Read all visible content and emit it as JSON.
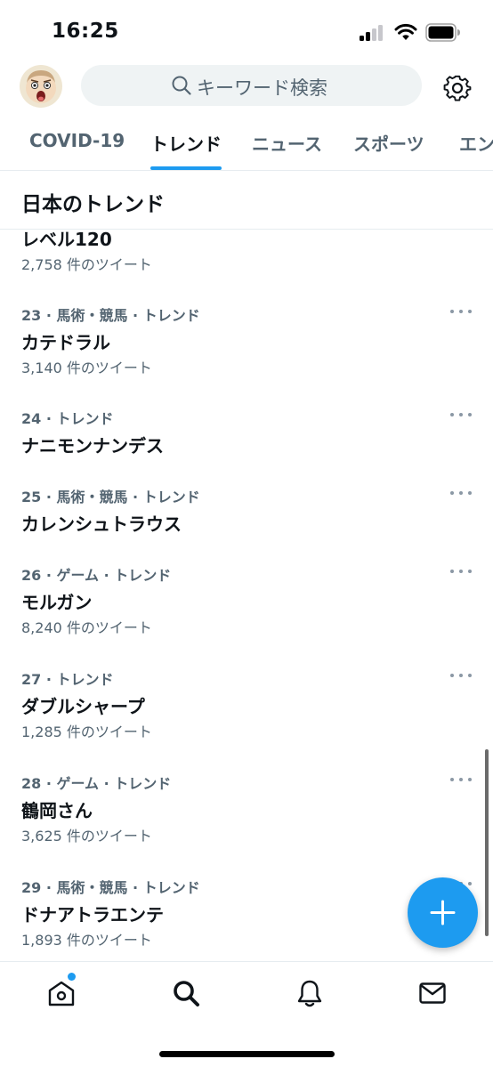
{
  "status_bar": {
    "time": "16:25"
  },
  "header": {
    "search_placeholder": "キーワード検索"
  },
  "tabs": [
    {
      "label": "COVID-19",
      "active": false
    },
    {
      "label": "トレンド",
      "active": true
    },
    {
      "label": "ニュース",
      "active": false
    },
    {
      "label": "スポーツ",
      "active": false
    },
    {
      "label": "エン",
      "active": false
    }
  ],
  "section": {
    "title": "日本のトレンド"
  },
  "trends": [
    {
      "meta": "",
      "name": "レベル120",
      "count": "2,758 件のツイート"
    },
    {
      "meta": "23 · 馬術・競馬 · トレンド",
      "name": "カテドラル",
      "count": "3,140 件のツイート"
    },
    {
      "meta": "24 · トレンド",
      "name": "ナニモンナンデス",
      "count": ""
    },
    {
      "meta": "25 · 馬術・競馬 · トレンド",
      "name": "カレンシュトラウス",
      "count": ""
    },
    {
      "meta": "26 · ゲーム · トレンド",
      "name": "モルガン",
      "count": "8,240 件のツイート"
    },
    {
      "meta": "27 · トレンド",
      "name": "ダブルシャープ",
      "count": "1,285 件のツイート"
    },
    {
      "meta": "28 · ゲーム · トレンド",
      "name": "鶴岡さん",
      "count": "3,625 件のツイート"
    },
    {
      "meta": "29 · 馬術・競馬 · トレンド",
      "name": "ドナアトラエンテ",
      "count": "1,893 件のツイート"
    }
  ],
  "icons": {
    "search": "search-icon",
    "settings": "gear-icon",
    "more": "more-icon",
    "compose": "plus-icon",
    "nav": [
      "home-icon",
      "explore-search-icon",
      "bell-icon",
      "mail-icon"
    ]
  },
  "colors": {
    "accent": "#1d9bf0",
    "text": "#0f1419",
    "secondary": "#536471"
  }
}
